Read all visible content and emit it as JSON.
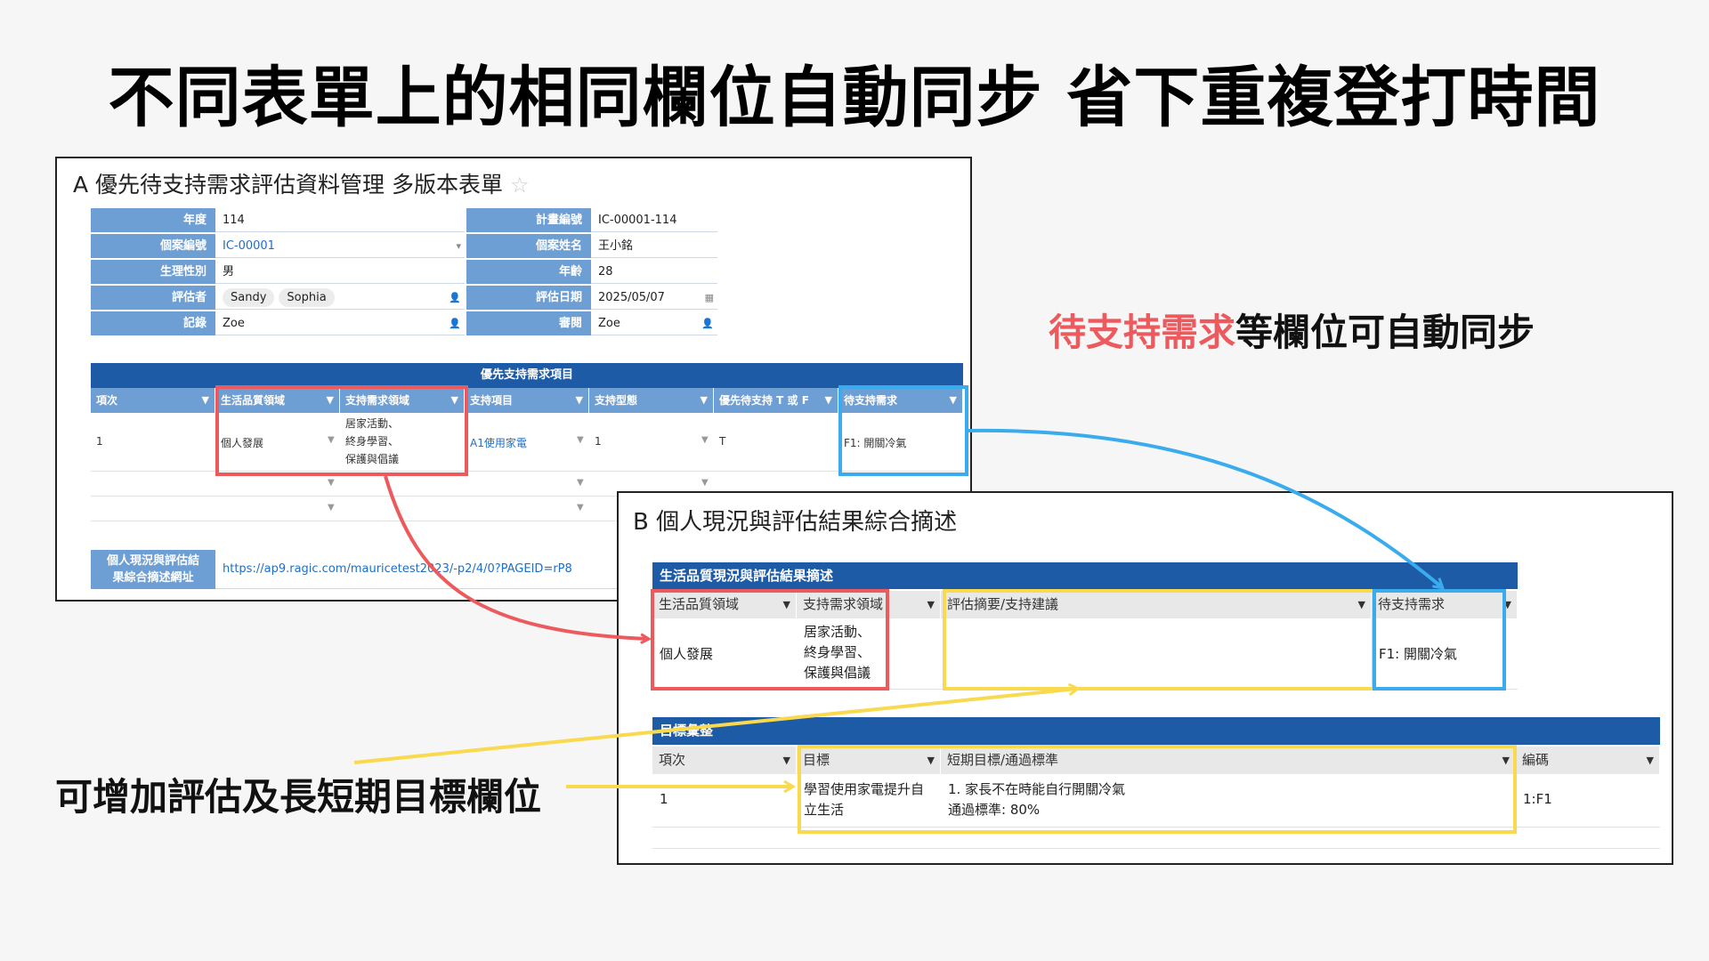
{
  "page_title": "不同表單上的相同欄位自動同步 省下重複登打時間",
  "panel_a": {
    "title": "A 優先待支持需求評估資料管理 多版本表單",
    "fields_left": [
      {
        "label": "年度",
        "value": "114"
      },
      {
        "label": "個案編號",
        "value": "IC-00001"
      },
      {
        "label": "生理性別",
        "value": "男"
      },
      {
        "label": "評估者",
        "chips": [
          "Sandy",
          "Sophia"
        ]
      },
      {
        "label": "記錄",
        "value": "Zoe"
      }
    ],
    "fields_right": [
      {
        "label": "計畫編號",
        "value": "IC-00001-114"
      },
      {
        "label": "個案姓名",
        "value": "王小銘"
      },
      {
        "label": "年齡",
        "value": "28"
      },
      {
        "label": "評估日期",
        "value": "2025/05/07"
      },
      {
        "label": "審閱",
        "value": "Zoe"
      }
    ],
    "subtable": {
      "title": "優先支持需求項目",
      "columns": [
        "項次",
        "生活品質領域",
        "支持需求領域",
        "支持項目",
        "支持型態",
        "優先待支持 T 或 F",
        "待支持需求"
      ],
      "row": {
        "no": "1",
        "quality": "個人發展",
        "support_area": [
          "居家活動、",
          "終身學習、",
          "保護與倡議"
        ],
        "item": "A1使用家電",
        "type": "1",
        "tf": "T",
        "need": "F1: 開關冷氣"
      }
    },
    "url_label": [
      "個人現況與評估結",
      "果綜合摘述網址"
    ],
    "url_value": "https://ap9.ragic.com/mauricetest2023/-p2/4/0?PAGEID=rP8"
  },
  "panel_b": {
    "title": "B 個人現況與評估結果綜合摘述",
    "table1": {
      "title": "生活品質現況與評估結果摘述",
      "columns": [
        "生活品質領域",
        "支持需求領域",
        "評估摘要/支持建議",
        "待支持需求"
      ],
      "row": {
        "quality": "個人發展",
        "support_area": [
          "居家活動、",
          "終身學習、",
          "保護與倡議"
        ],
        "summary": "",
        "need": "F1: 開關冷氣"
      }
    },
    "table2": {
      "title": "目標彙整",
      "columns": [
        "項次",
        "目標",
        "短期目標/通過標準",
        "編碼"
      ],
      "row": {
        "no": "1",
        "goal": [
          "學習使用家電提升自",
          "立生活"
        ],
        "short_term": [
          "1. 家長不在時能自行開關冷氣",
          "通過標準: 80%"
        ],
        "code": "1:F1"
      }
    }
  },
  "annotations": {
    "sync_highlight": "待支持需求",
    "sync_rest": "等欄位可自動同步",
    "add_fields": "可增加評估及長短期目標欄位"
  },
  "colors": {
    "red": "#ec5a5e",
    "blue": "#3aacee",
    "yellow": "#f9d94e",
    "header_blue": "#1e5ba7",
    "field_blue": "#6e9fd4"
  },
  "icons": {
    "star": "star-icon",
    "user": "user-icon",
    "calendar": "calendar-icon",
    "dropdown": "caret-down-icon"
  }
}
